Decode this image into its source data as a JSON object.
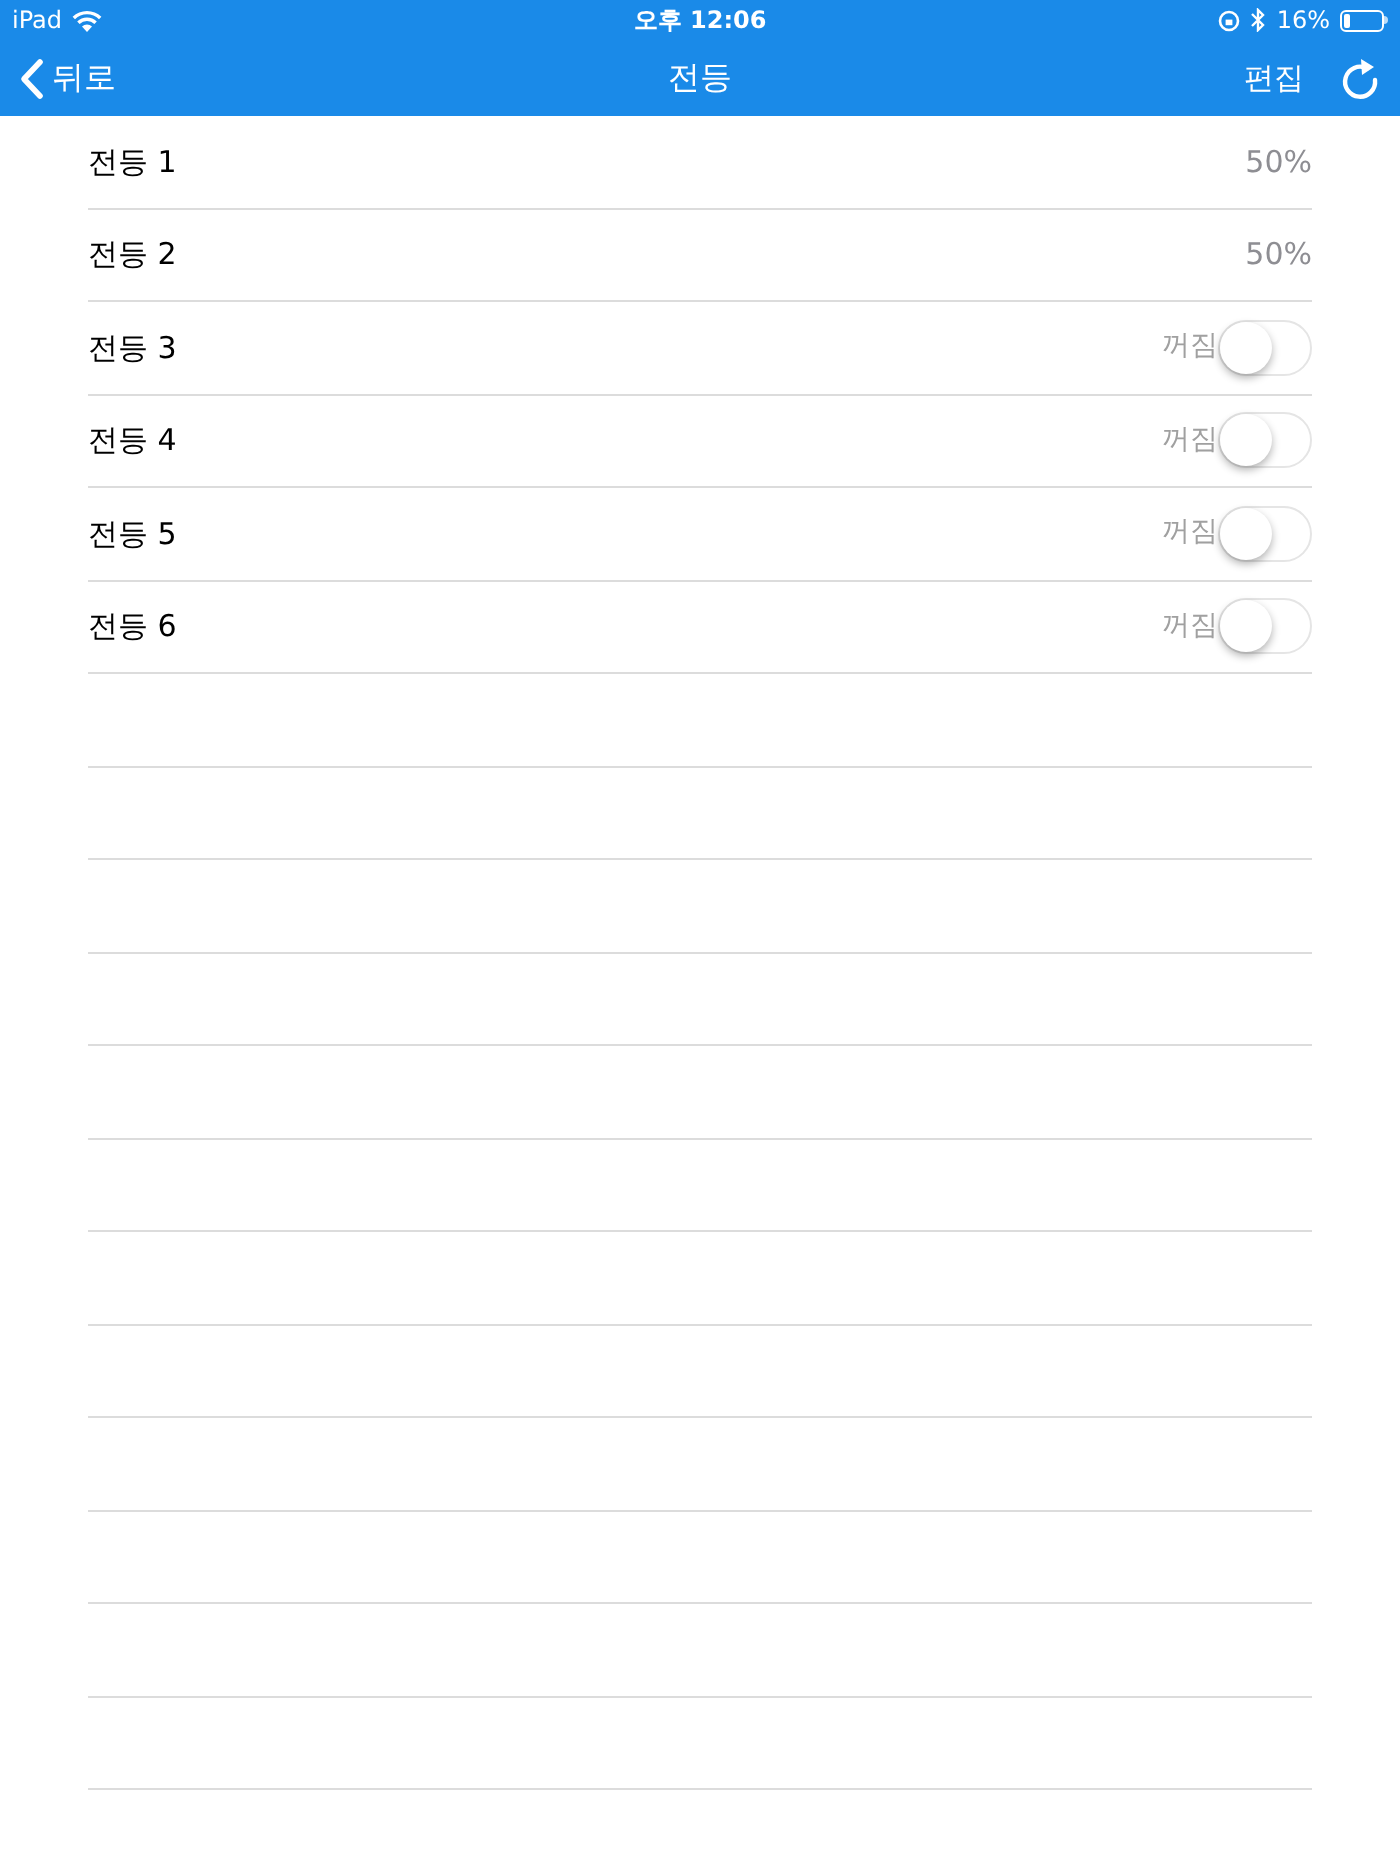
{
  "status_bar": {
    "device": "iPad",
    "time": "오후 12:06",
    "battery": "16%"
  },
  "nav_bar": {
    "back": "뒤로",
    "title": "전등",
    "edit": "편집"
  },
  "lights": [
    {
      "name": "전등 1",
      "kind": "value",
      "value": "50%"
    },
    {
      "name": "전등 2",
      "kind": "value",
      "value": "50%"
    },
    {
      "name": "전등 3",
      "kind": "switch",
      "state_text": "꺼짐",
      "on": false
    },
    {
      "name": "전등 4",
      "kind": "switch",
      "state_text": "꺼짐",
      "on": false
    },
    {
      "name": "전등 5",
      "kind": "switch",
      "state_text": "꺼짐",
      "on": false
    },
    {
      "name": "전등 6",
      "kind": "switch",
      "state_text": "꺼짐",
      "on": false
    }
  ]
}
